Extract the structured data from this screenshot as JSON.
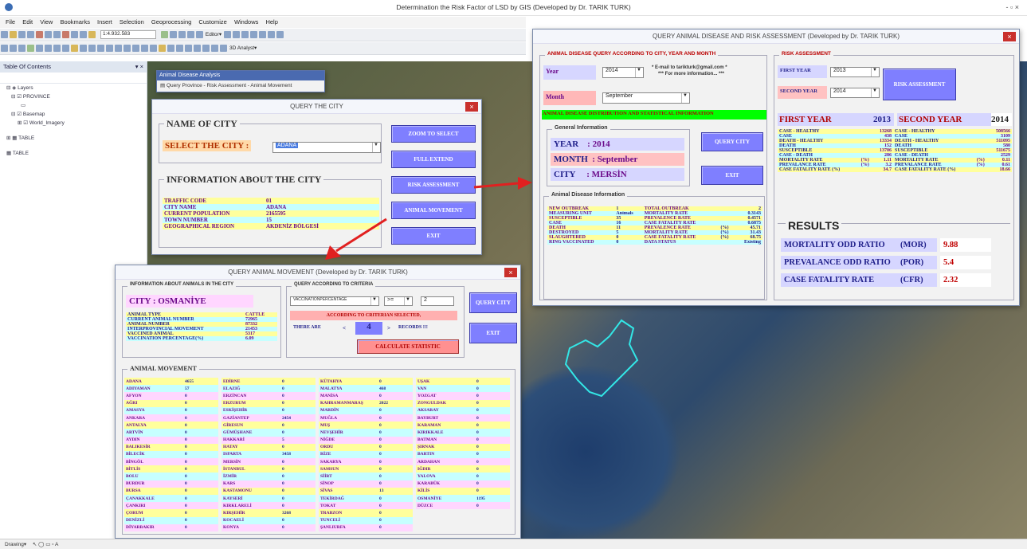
{
  "app": {
    "title": "Determination the Risk Factor of LSD by GIS (Developed by Dr. TARIK TURK)",
    "controls": "-  ▫  ×"
  },
  "menu": [
    "File",
    "Edit",
    "View",
    "Bookmarks",
    "Insert",
    "Selection",
    "Geoprocessing",
    "Customize",
    "Windows",
    "Help"
  ],
  "toolbar": {
    "scale": "1:4.932.583",
    "editor": "Editor▾",
    "analyst": "3D Analyst▾"
  },
  "toc": {
    "title": "Table Of Contents",
    "pin": "▾ ×",
    "items": [
      "Layers",
      "PROVINCE",
      "Basemap",
      "World_Imagery",
      "TABLE",
      "TABLE"
    ]
  },
  "analysis_window": {
    "title": "Animal Disease Analysis",
    "item": "Query Province - Risk Assessment - Animal Movement"
  },
  "query_city": {
    "title": "QUERY THE CITY",
    "name_group": "NAME OF CITY",
    "select_label": "SELECT THE CITY :",
    "selected": "ADANA",
    "info_group": "INFORMATION ABOUT THE CITY",
    "rows": [
      {
        "k": "TRAFFIC CODE",
        "v": "01"
      },
      {
        "k": "CITY NAME",
        "v": "ADANA"
      },
      {
        "k": "CURRENT POPULATION",
        "v": "2165595"
      },
      {
        "k": "TOWN NUMBER",
        "v": "15"
      },
      {
        "k": "GEOGRAPHICAL REGION",
        "v": "AKDENİZ BÖLGESİ"
      }
    ],
    "buttons": [
      "ZOOM TO SELECT",
      "FULL EXTEND",
      "RISK ASSESSMENT",
      "ANIMAL MOVEMENT",
      "EXIT"
    ]
  },
  "risk": {
    "title": "QUERY ANIMAL DISEASE AND RISK ASSESSMENT (Developed by Dr. TARIK TURK)",
    "query_group": "ANIMAL DISEASE QUERY ACCORDING TO CITY, YEAR AND MONTH",
    "year_label": "Year",
    "year_value": "2014",
    "email_note": "* E-mail to tarikturk@gmail.com *",
    "more_info": "*** For more information... ***",
    "month_label": "Month",
    "month_value": "September",
    "dist_banner": "ANIMAL DISEASE DISTRIBUTION AND STATISTICAL INFORMATION",
    "general_group": "General Information",
    "general": [
      {
        "k": "YEAR",
        "v": ": 2014"
      },
      {
        "k": "MONTH",
        "v": ": September"
      },
      {
        "k": "CITY",
        "v": ": MERSİN"
      }
    ],
    "query_city_btn": "QUERY CITY",
    "exit_btn": "EXIT",
    "disease_group": "Animal Disease Information",
    "disease_rows": [
      [
        "NEW OUTBREAK",
        "1",
        "TOTAL OUTBREAK",
        "",
        "2"
      ],
      [
        "MEASURING UNIT",
        "Animals",
        "MORTALITY RATE",
        "",
        "0.3143"
      ],
      [
        "SUSCEPTIBLE",
        "35",
        "PREVALENCE RATE",
        "",
        "0.4571"
      ],
      [
        "CASE",
        "16",
        "CASE FATALITY RATE",
        "",
        "0.6875"
      ],
      [
        "DEATH",
        "11",
        "PREVALENCE RATE",
        "(%)",
        "45.71"
      ],
      [
        "DESTROYED",
        "5",
        "MORTALITY RATE",
        "(%)",
        "31.43"
      ],
      [
        "SLAUGHTERED",
        "0",
        "CASE FATALITY RATE",
        "(%)",
        "68.75"
      ],
      [
        "RING VACCINATED",
        "0",
        "DATA STATUS",
        "",
        "Existing"
      ]
    ],
    "ra_group": "RISK ASSESSMENT",
    "first_year_label": "FIRST YEAR",
    "first_year": "2013",
    "second_year_label": "SECOND YEAR",
    "second_year": "2014",
    "ra_btn": "RISK ASSESSMENT",
    "hdr_first": "FIRST YEAR",
    "hdr_first_v": "2013",
    "hdr_second": "SECOND YEAR",
    "hdr_second_v": "2014",
    "ra_rows": [
      [
        "CASE - HEALTHY",
        "",
        "13268",
        "CASE - HEALTHY",
        "",
        "508566"
      ],
      [
        "CASE",
        "",
        "438",
        "CASE",
        "",
        "3109"
      ],
      [
        "DEATH - HEALTHY",
        "",
        "13334",
        "DEATH - HEALTHY",
        "",
        "511095"
      ],
      [
        "DEATH",
        "",
        "152",
        "DEATH",
        "",
        "580"
      ],
      [
        "SUSCEPTIBLE",
        "",
        "13706",
        "SUSCEPTIBLE",
        "",
        "511675"
      ],
      [
        "CASE - DEATH",
        "",
        "286",
        "CASE - DEATH",
        "",
        "2529"
      ],
      [
        "MORTALITY RATE",
        "(%)",
        "1.11",
        "MORTALITY RATE",
        "(%)",
        "0.11"
      ],
      [
        "PREVALANCE RATE",
        "(%)",
        "3.2",
        "PREVALANCE RATE",
        "(%)",
        "0.61"
      ],
      [
        "CASE FATALITY RATE (%)",
        "",
        "34.7",
        "CASE FATALITY RATE (%)",
        "",
        "18.66"
      ]
    ],
    "results_title": "RESULTS",
    "results": [
      {
        "k": "MORTALITY ODD RATIO",
        "abbr": "(MOR)",
        "v": "9.88"
      },
      {
        "k": "PREVALANCE ODD RATIO",
        "abbr": "(POR)",
        "v": "5.4"
      },
      {
        "k": "CASE FATALITY RATE",
        "abbr": "(CFR)",
        "v": "2.32"
      }
    ]
  },
  "movement": {
    "title": "QUERY ANIMAL MOVEMENT (Developed by Dr. TARIK TURK)",
    "info_group": "INFORMATION ABOUT ANIMALS IN THE CITY",
    "city": "CITY : OSMANİYE",
    "info_rows": [
      [
        "ANIMAL TYPE",
        "CATTLE"
      ],
      [
        "CURRENT ANIMAL NUMBER",
        "72965"
      ],
      [
        "ANIMAL NUMBER",
        "87332"
      ],
      [
        "INTERPROVINCIAL MOVEMENT",
        "21453"
      ],
      [
        "VACCINED ANIMAL",
        "5317"
      ],
      [
        "VACCINATION PERCENTAGE(%)",
        "6.09"
      ]
    ],
    "criteria_group": "QUERY ACCORDING TO CRITERIA",
    "criteria_field": "VACCINATIONPERCENTAGE",
    "criteria_op": ">=",
    "criteria_val": "2",
    "criteria_msg": "ACCORDING TO CRITERIAN SELECTED,",
    "there_are": "THERE ARE",
    "lt": "<",
    "count": "4",
    "gt": ">",
    "records": "RECORDS !!!",
    "calc_btn": "CALCULATE STATISTIC",
    "query_btn": "QUERY CITY",
    "exit_btn": "EXIT",
    "movement_title": "ANIMAL MOVEMENT",
    "columns": [
      [
        [
          "ADANA",
          "4655"
        ],
        [
          "ADIYAMAN",
          "57"
        ],
        [
          "AFYON",
          "0"
        ],
        [
          "AĞRI",
          "0"
        ],
        [
          "AMASYA",
          "0"
        ],
        [
          "ANKARA",
          "0"
        ],
        [
          "ANTALYA",
          "0"
        ],
        [
          "ARTVİN",
          "0"
        ],
        [
          "AYDIN",
          "0"
        ],
        [
          "BALIKESİR",
          "0"
        ],
        [
          "BİLECİK",
          "0"
        ],
        [
          "BİNGÖL",
          "0"
        ],
        [
          "BİTLİS",
          "0"
        ],
        [
          "BOLU",
          "0"
        ],
        [
          "BURDUR",
          "0"
        ],
        [
          "BURSA",
          "0"
        ],
        [
          "ÇANAKKALE",
          "0"
        ],
        [
          "ÇANKIRI",
          "0"
        ],
        [
          "ÇORUM",
          "0"
        ],
        [
          "DENİZLİ",
          "0"
        ],
        [
          "DİYARBAKIR",
          "0"
        ]
      ],
      [
        [
          "EDİRNE",
          "0"
        ],
        [
          "ELAZIĞ",
          "0"
        ],
        [
          "ERZİNCAN",
          "0"
        ],
        [
          "ERZURUM",
          "0"
        ],
        [
          "ESKİŞEHİR",
          "0"
        ],
        [
          "GAZİANTEP",
          "2454"
        ],
        [
          "GİRESUN",
          "0"
        ],
        [
          "GÜMÜŞHANE",
          "0"
        ],
        [
          "HAKKARİ",
          "5"
        ],
        [
          "HATAY",
          "0"
        ],
        [
          "ISPARTA",
          "3458"
        ],
        [
          "MERSİN",
          "0"
        ],
        [
          "İSTANBUL",
          "0"
        ],
        [
          "İZMİR",
          "0"
        ],
        [
          "KARS",
          "0"
        ],
        [
          "KASTAMONU",
          "0"
        ],
        [
          "KAYSERİ",
          "0"
        ],
        [
          "KIRKLARELİ",
          "0"
        ],
        [
          "KIRŞEHİR",
          "3268"
        ],
        [
          "KOCAELİ",
          "0"
        ],
        [
          "KONYA",
          "0"
        ]
      ],
      [
        [
          "KÜTAHYA",
          "0"
        ],
        [
          "MALATYA",
          "468"
        ],
        [
          "MANİSA",
          "0"
        ],
        [
          "KAHRAMANMARAŞ",
          "2022"
        ],
        [
          "MARDİN",
          "0"
        ],
        [
          "MUĞLA",
          "0"
        ],
        [
          "MUŞ",
          "0"
        ],
        [
          "NEVŞEHİR",
          "0"
        ],
        [
          "NİĞDE",
          "0"
        ],
        [
          "ORDU",
          "0"
        ],
        [
          "RİZE",
          "0"
        ],
        [
          "SAKARYA",
          "0"
        ],
        [
          "SAMSUN",
          "0"
        ],
        [
          "SİİRT",
          "0"
        ],
        [
          "SİNOP",
          "0"
        ],
        [
          "SİVAS",
          "13"
        ],
        [
          "TEKİRDAĞ",
          "0"
        ],
        [
          "TOKAT",
          "0"
        ],
        [
          "TRABZON",
          "0"
        ],
        [
          "TUNCELİ",
          "0"
        ],
        [
          "ŞANLIURFA",
          "0"
        ]
      ],
      [
        [
          "UŞAK",
          "0"
        ],
        [
          "VAN",
          "0"
        ],
        [
          "YOZGAT",
          "0"
        ],
        [
          "ZONGULDAK",
          "0"
        ],
        [
          "AKSARAY",
          "0"
        ],
        [
          "BAYBURT",
          "0"
        ],
        [
          "KARAMAN",
          "0"
        ],
        [
          "KIRIKKALE",
          "0"
        ],
        [
          "BATMAN",
          "0"
        ],
        [
          "ŞIRNAK",
          "0"
        ],
        [
          "BARTIN",
          "0"
        ],
        [
          "ARDAHAN",
          "0"
        ],
        [
          "IĞDIR",
          "0"
        ],
        [
          "YALOVA",
          "0"
        ],
        [
          "KARABÜK",
          "0"
        ],
        [
          "KİLİS",
          "0"
        ],
        [
          "OSMANİYE",
          "1195"
        ],
        [
          "DÜZCE",
          "0"
        ]
      ]
    ]
  },
  "status": "Drawing▾"
}
